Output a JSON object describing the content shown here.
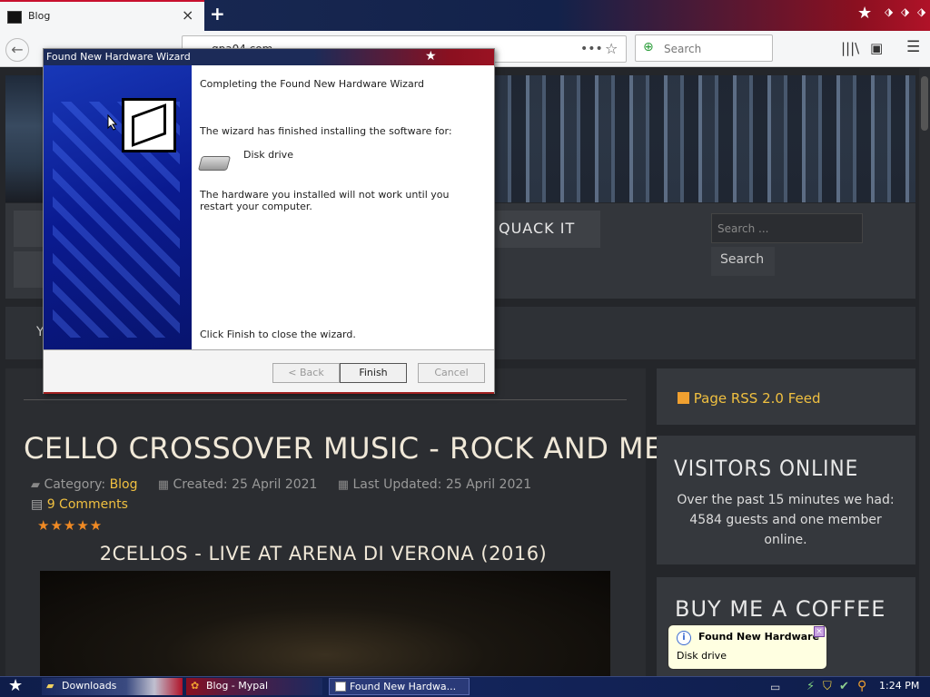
{
  "browser": {
    "tab_title": "Blog",
    "tab_close": "×",
    "new_tab": "+",
    "url": "gpa04.com",
    "search_placeholder": "Search"
  },
  "site": {
    "menu_item": "QUACK IT",
    "search_placeholder": "Search ...",
    "search_button": "Search",
    "band_text": "Y",
    "rss_label": "Page RSS 2.0 Feed",
    "visitors_title": "VISITORS ONLINE",
    "visitors_text": "Over the past 15 minutes we had: 4584 guests and one member online.",
    "coffee_title": "BUY ME A COFFEE"
  },
  "article": {
    "title": "CELLO CROSSOVER MUSIC - ROCK AND METAL",
    "category_label": "Category:",
    "category": "Blog",
    "created": "Created: 25 April 2021",
    "updated": "Last Updated: 25 April 2021",
    "comments": "9 Comments",
    "rating": "★★★★★",
    "subtitle": "2CELLOS - LIVE AT ARENA DI VERONA (2016)"
  },
  "wizard": {
    "title": "Found New Hardware Wizard",
    "heading": "Completing the Found New Hardware Wizard",
    "line1": "The wizard has finished installing the software for:",
    "device": "Disk drive",
    "line2": "The hardware you installed will not work until you restart your computer.",
    "footer": "Click Finish to close the wizard.",
    "back": "< Back",
    "finish": "Finish",
    "cancel": "Cancel"
  },
  "notification": {
    "title": "Found New Hardware",
    "body": "Disk drive"
  },
  "taskbar": {
    "task1": "Downloads",
    "task2": "Blog - Mypal",
    "task3": "Found New Hardwa...",
    "clock": "1:24 PM"
  }
}
